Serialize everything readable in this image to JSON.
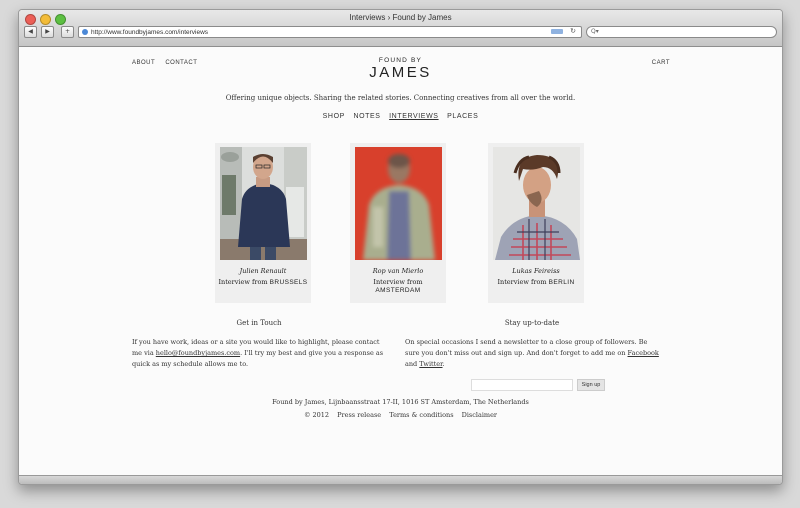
{
  "browser": {
    "title": "Interviews › Found by James",
    "url": "http://www.foundbyjames.com/interviews",
    "search_placeholder": "Q▾",
    "back": "◀",
    "forward": "▶",
    "add_tab": "+",
    "reload": "↻"
  },
  "site": {
    "topnav": [
      "ABOUT",
      "CONTACT"
    ],
    "cart": "CART",
    "logo_small": "FOUND BY",
    "logo_big": "JAMES",
    "tagline": "Offering unique objects. Sharing the related stories. Connecting creatives from all over the world.",
    "mainnav": [
      "SHOP",
      "NOTES",
      "INTERVIEWS",
      "PLACES"
    ]
  },
  "interviews": [
    {
      "name": "Julien Renault",
      "from": "Interview from ",
      "city": "BRUSSELS"
    },
    {
      "name": "Rop van Mierlo",
      "from": "Interview from ",
      "city": "AMSTERDAM"
    },
    {
      "name": "Lukas Feireiss",
      "from": "Interview from ",
      "city": "BERLIN"
    }
  ],
  "contact": {
    "title": "Get in Touch",
    "text1": "If you have work, ideas or a site you would like to highlight, please contact me via ",
    "email": "hello@foundbyjames.com",
    "text2": ". I'll try my best and give you a response as quick as my schedule allows me to."
  },
  "newsletter": {
    "title": "Stay up-to-date",
    "text1": "On special occasions I send a newsletter to a close group of followers. Be sure you don't miss out and sign up. And don't forget to add me on ",
    "facebook": "Facebook",
    "and": " and ",
    "twitter": "Twitter",
    "end": ".",
    "button": "Sign up"
  },
  "footer": {
    "address": "Found by James, Lijnbaansstraat 17-II, 1016 ST Amsterdam, The Netherlands",
    "copyright": "© 2012",
    "links": [
      "Press release",
      "Terms & conditions",
      "Disclaimer"
    ]
  }
}
